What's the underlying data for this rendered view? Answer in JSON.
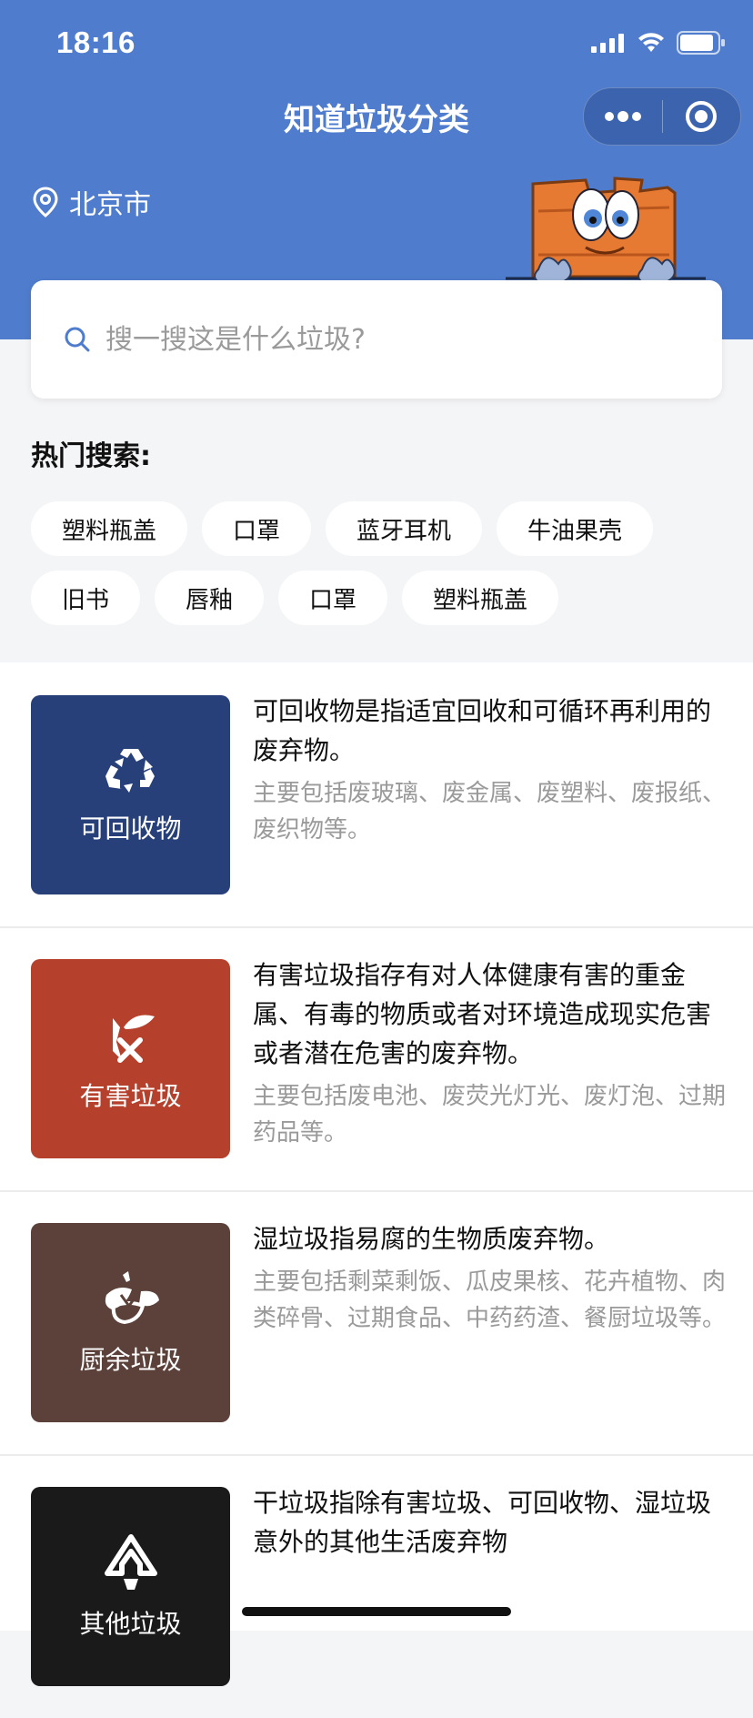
{
  "status_bar": {
    "time": "18:16"
  },
  "nav": {
    "title": "知道垃圾分类"
  },
  "location": {
    "city": "北京市"
  },
  "search": {
    "placeholder": "搜一搜这是什么垃圾?"
  },
  "hot": {
    "title": "热门搜索:",
    "row1": [
      "塑料瓶盖",
      "口罩",
      "蓝牙耳机",
      "牛油果壳"
    ],
    "row2": [
      "旧书",
      "唇釉",
      "口罩",
      "塑料瓶盖"
    ]
  },
  "categories": [
    {
      "label": "可回收物",
      "color": "#27407a",
      "icon": "recycle-icon",
      "description": "可回收物是指适宜回收和可循环再利用的废弃物。",
      "examples": "主要包括废玻璃、废金属、废塑料、废报纸、废织物等。"
    },
    {
      "label": "有害垃圾",
      "color": "#b5402c",
      "icon": "hazardous-icon",
      "description": "有害垃圾指存有对人体健康有害的重金属、有毒的物质或者对环境造成现实危害或者潜在危害的废弃物。",
      "examples": "主要包括废电池、废荧光灯光、废灯泡、过期药品等。"
    },
    {
      "label": "厨余垃圾",
      "color": "#5b4139",
      "icon": "kitchen-waste-icon",
      "description": "湿垃圾指易腐的生物质废弃物。",
      "examples": "主要包括剩菜剩饭、瓜皮果核、花卉植物、肉类碎骨、过期食品、中药药渣、餐厨垃圾等。"
    },
    {
      "label": "其他垃圾",
      "color": "#1a1a1a",
      "icon": "other-waste-icon",
      "description": "干垃圾指除有害垃圾、可回收物、湿垃圾意外的其他生活废弃物",
      "examples": ""
    }
  ],
  "colors": {
    "header": "#4f7ccc",
    "background": "#f4f5f7"
  }
}
